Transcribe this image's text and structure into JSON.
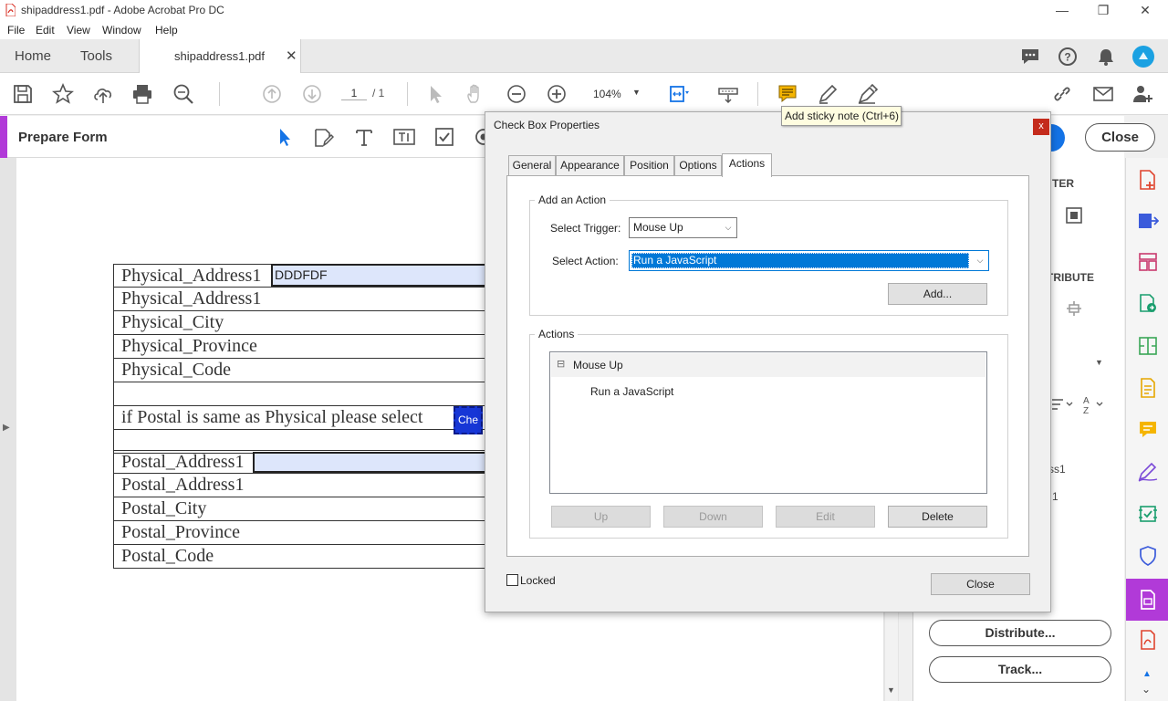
{
  "window": {
    "title": "shipaddress1.pdf - Adobe Acrobat Pro DC",
    "minimize": "—",
    "restore": "❐",
    "close": "✕"
  },
  "menu": [
    "File",
    "Edit",
    "View",
    "Window",
    "Help"
  ],
  "tabs": {
    "home": "Home",
    "tools": "Tools",
    "document": "shipaddress1.pdf",
    "document_close": "✕"
  },
  "toolbar": {
    "page_current": "1",
    "page_total": "/ 1",
    "zoom": "104%",
    "tooltip": "Add sticky note (Ctrl+6)"
  },
  "formbar": {
    "title": "Prepare Form"
  },
  "document": {
    "rows_top": [
      "Physical_Address1",
      "Physical_Address1",
      "Physical_City",
      "Physical_Province",
      "Physical_Code"
    ],
    "middle_row": "if Postal is same as Physical please select",
    "rows_bottom": [
      "Postal_Address1",
      "Postal_Address1",
      "Postal_City",
      "Postal_Province",
      "Postal_Code"
    ],
    "field_value": "DDDFDF",
    "checkbox_label": "Che"
  },
  "right_pane": {
    "frag_ter": "TER",
    "frag_distribute": "TRIBUTE",
    "frag_ss1": "ss1",
    "frag_1": "1",
    "close_button": "Close",
    "distribute_button": "Distribute...",
    "track_button": "Track..."
  },
  "dialog": {
    "title": "Check Box Properties",
    "tabs": [
      "General",
      "Appearance",
      "Position",
      "Options",
      "Actions"
    ],
    "active_tab": "Actions",
    "add_action_group": "Add an Action",
    "trigger_label": "Select Trigger:",
    "trigger_value": "Mouse Up",
    "action_label": "Select Action:",
    "action_value": "Run a JavaScript",
    "add_button": "Add...",
    "actions_group": "Actions",
    "tree_parent": "Mouse Up",
    "tree_child": "Run a JavaScript",
    "tree_toggle": "⊟",
    "up_button": "Up",
    "down_button": "Down",
    "edit_button": "Edit",
    "delete_button": "Delete",
    "locked_label": "Locked",
    "close_button": "Close",
    "close_x": "x"
  },
  "colors": {
    "accent_purple": "#b13ad8",
    "selection_blue": "#0078d7",
    "field_fill": "#dde6fb",
    "acrobat_blue": "#1473e6"
  }
}
